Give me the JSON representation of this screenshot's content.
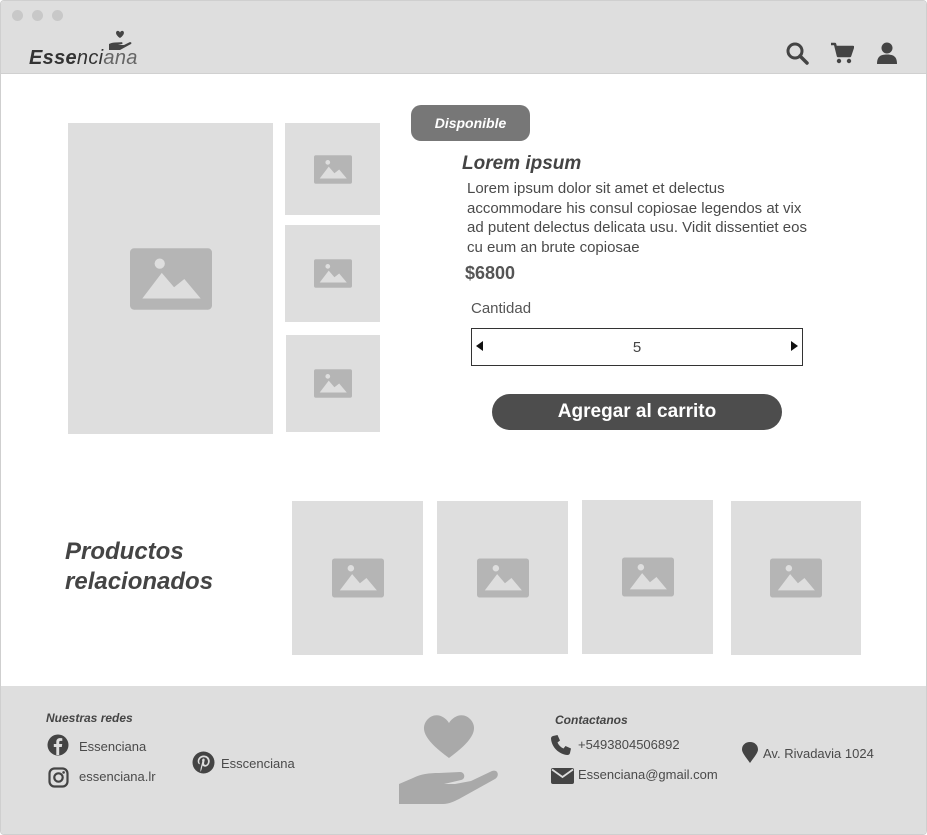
{
  "header": {
    "logo_part1": "Esse",
    "logo_part2": "nci",
    "logo_part3": "ana",
    "icons": [
      "search-icon",
      "cart-icon",
      "user-icon"
    ]
  },
  "product": {
    "badge": "Disponible",
    "title": "Lorem ipsum",
    "description": "Lorem ipsum dolor sit amet et delectus accommodare his consul copiosae legendos at vix ad putent delectus delicata usu. Vidit dissentiet eos cu eum an brute copiosae",
    "price": "$6800",
    "quantity_label": "Cantidad",
    "quantity_value": "5",
    "add_to_cart": "Agregar al carrito"
  },
  "related": {
    "title_line1": "Productos",
    "title_line2": "relacionados"
  },
  "footer": {
    "social_heading": "Nuestras redes",
    "facebook": "Essenciana",
    "instagram": "essenciana.lr",
    "pinterest": "Esscenciana",
    "contact_heading": "Contactanos",
    "phone": "+5493804506892",
    "email": "Essenciana@gmail.com",
    "address": "Av. Rivadavia 1024"
  },
  "colors": {
    "placeholder": "#dedede",
    "placeholder_icon": "#b5b5b5",
    "button": "#4d4d4d",
    "badge": "#777777"
  }
}
